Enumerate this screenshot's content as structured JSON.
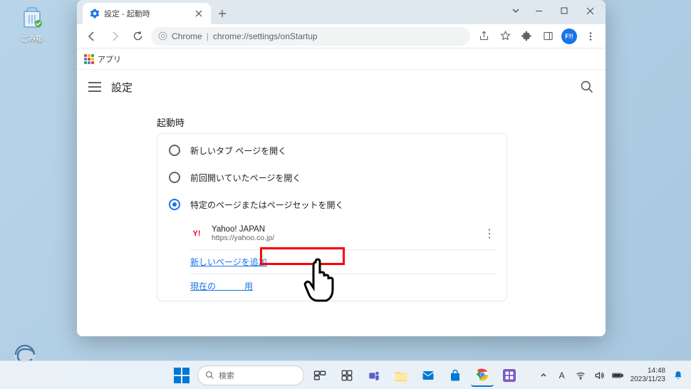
{
  "desktop": {
    "recycle_label": "ごみ箱"
  },
  "tab": {
    "title": "設定 - 起動時"
  },
  "omnibox": {
    "chip": "Chrome",
    "path": "chrome://settings/onStartup"
  },
  "bookmarks": {
    "apps": "アプリ"
  },
  "settings": {
    "title": "設定",
    "section": "起動時",
    "options": {
      "new_tab": "新しいタブ ページを開く",
      "continue": "前回開いていたページを開く",
      "specific": "特定のページまたはページセットを開く"
    },
    "page": {
      "name": "Yahoo! JAPAN",
      "url": "https://yahoo.co.jp/",
      "fav": "Y!"
    },
    "links": {
      "add": "新しいページを追加",
      "use_current_prefix": "現在の",
      "use_current_suffix": "用"
    }
  },
  "avatar": "F!!",
  "taskbar": {
    "search_placeholder": "検索",
    "ime": "A",
    "time": "14:48",
    "date": "2023/11/23"
  }
}
